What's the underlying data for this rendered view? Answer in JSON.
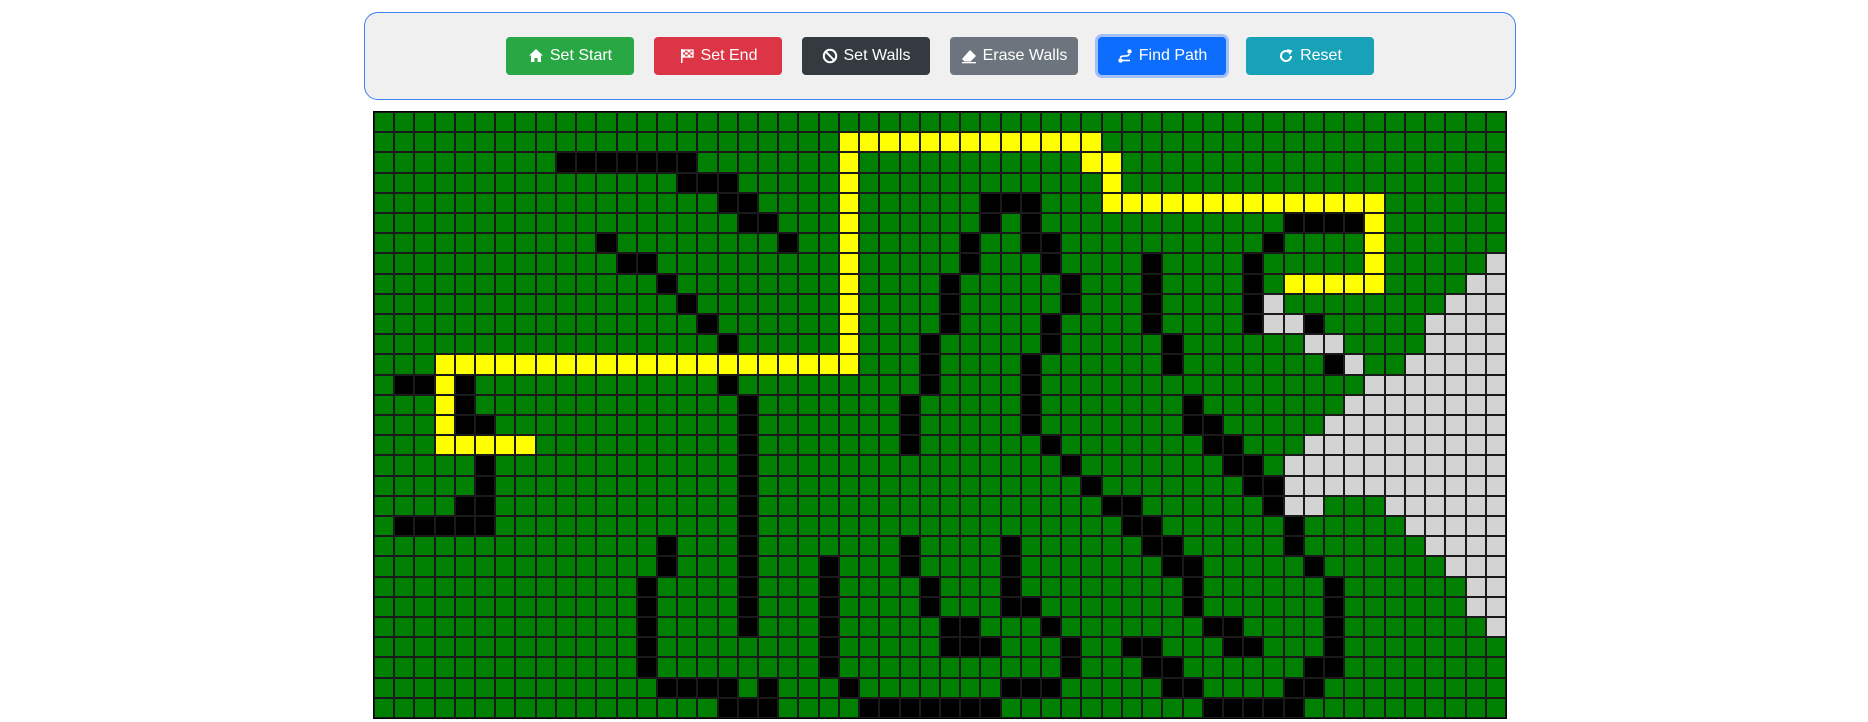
{
  "toolbar": {
    "buttons": [
      {
        "id": "start",
        "label": "Set Start",
        "icon": "home-icon",
        "color": "#28a745"
      },
      {
        "id": "end",
        "label": "Set End",
        "icon": "flag-checkered-icon",
        "color": "#dc3545"
      },
      {
        "id": "walls",
        "label": "Set Walls",
        "icon": "ban-icon",
        "color": "#343a40"
      },
      {
        "id": "erase",
        "label": "Erase Walls",
        "icon": "eraser-icon",
        "color": "#6c757d"
      },
      {
        "id": "find",
        "label": "Find Path",
        "icon": "route-icon",
        "color": "#0d6efd",
        "active": true
      },
      {
        "id": "reset",
        "label": "Reset",
        "icon": "redo-icon",
        "color": "#17a2b8"
      }
    ]
  },
  "grid": {
    "cols": 56,
    "rows": 30,
    "colors": {
      "empty": "#008000",
      "wall": "#000000",
      "path": "#ffff00",
      "visited": "#d3d3d3"
    },
    "walls": [
      [
        2,
        9
      ],
      [
        2,
        10
      ],
      [
        2,
        11
      ],
      [
        2,
        12
      ],
      [
        2,
        13
      ],
      [
        2,
        14
      ],
      [
        2,
        15
      ],
      [
        3,
        15
      ],
      [
        3,
        16
      ],
      [
        3,
        17
      ],
      [
        4,
        17
      ],
      [
        4,
        18
      ],
      [
        4,
        30
      ],
      [
        4,
        31
      ],
      [
        4,
        32
      ],
      [
        5,
        18
      ],
      [
        5,
        19
      ],
      [
        5,
        30
      ],
      [
        5,
        32
      ],
      [
        5,
        45
      ],
      [
        5,
        46
      ],
      [
        5,
        47
      ],
      [
        5,
        48
      ],
      [
        6,
        11
      ],
      [
        6,
        20
      ],
      [
        6,
        29
      ],
      [
        6,
        32
      ],
      [
        6,
        33
      ],
      [
        6,
        44
      ],
      [
        7,
        12
      ],
      [
        7,
        13
      ],
      [
        7,
        29
      ],
      [
        7,
        33
      ],
      [
        7,
        38
      ],
      [
        7,
        43
      ],
      [
        8,
        14
      ],
      [
        8,
        28
      ],
      [
        8,
        34
      ],
      [
        8,
        38
      ],
      [
        8,
        43
      ],
      [
        9,
        15
      ],
      [
        9,
        28
      ],
      [
        9,
        34
      ],
      [
        9,
        38
      ],
      [
        9,
        43
      ],
      [
        10,
        16
      ],
      [
        10,
        28
      ],
      [
        10,
        33
      ],
      [
        10,
        38
      ],
      [
        10,
        43
      ],
      [
        10,
        44
      ],
      [
        10,
        45
      ],
      [
        10,
        46
      ],
      [
        11,
        17
      ],
      [
        11,
        27
      ],
      [
        11,
        33
      ],
      [
        11,
        39
      ],
      [
        11,
        46
      ],
      [
        11,
        47
      ],
      [
        12,
        27
      ],
      [
        12,
        32
      ],
      [
        12,
        39
      ],
      [
        12,
        47
      ],
      [
        12,
        48
      ],
      [
        13,
        1
      ],
      [
        13,
        2
      ],
      [
        13,
        3
      ],
      [
        13,
        4
      ],
      [
        13,
        17
      ],
      [
        13,
        27
      ],
      [
        13,
        32
      ],
      [
        14,
        4
      ],
      [
        14,
        18
      ],
      [
        14,
        26
      ],
      [
        14,
        32
      ],
      [
        14,
        40
      ],
      [
        15,
        4
      ],
      [
        15,
        5
      ],
      [
        15,
        18
      ],
      [
        15,
        26
      ],
      [
        15,
        32
      ],
      [
        15,
        40
      ],
      [
        15,
        41
      ],
      [
        16,
        5
      ],
      [
        16,
        18
      ],
      [
        16,
        26
      ],
      [
        16,
        33
      ],
      [
        16,
        41
      ],
      [
        16,
        42
      ],
      [
        17,
        5
      ],
      [
        17,
        18
      ],
      [
        17,
        34
      ],
      [
        17,
        42
      ],
      [
        17,
        43
      ],
      [
        18,
        5
      ],
      [
        18,
        18
      ],
      [
        18,
        35
      ],
      [
        18,
        43
      ],
      [
        18,
        44
      ],
      [
        19,
        4
      ],
      [
        19,
        5
      ],
      [
        19,
        18
      ],
      [
        19,
        36
      ],
      [
        19,
        37
      ],
      [
        19,
        44
      ],
      [
        19,
        45
      ],
      [
        20,
        1
      ],
      [
        20,
        2
      ],
      [
        20,
        3
      ],
      [
        20,
        4
      ],
      [
        20,
        5
      ],
      [
        20,
        18
      ],
      [
        20,
        37
      ],
      [
        20,
        38
      ],
      [
        20,
        45
      ],
      [
        21,
        14
      ],
      [
        21,
        18
      ],
      [
        21,
        26
      ],
      [
        21,
        31
      ],
      [
        21,
        38
      ],
      [
        21,
        39
      ],
      [
        21,
        45
      ],
      [
        22,
        14
      ],
      [
        22,
        18
      ],
      [
        22,
        22
      ],
      [
        22,
        26
      ],
      [
        22,
        31
      ],
      [
        22,
        39
      ],
      [
        22,
        40
      ],
      [
        22,
        46
      ],
      [
        23,
        13
      ],
      [
        23,
        18
      ],
      [
        23,
        22
      ],
      [
        23,
        27
      ],
      [
        23,
        31
      ],
      [
        23,
        40
      ],
      [
        23,
        47
      ],
      [
        24,
        13
      ],
      [
        24,
        18
      ],
      [
        24,
        22
      ],
      [
        24,
        27
      ],
      [
        24,
        31
      ],
      [
        24,
        32
      ],
      [
        24,
        40
      ],
      [
        24,
        47
      ],
      [
        25,
        13
      ],
      [
        25,
        18
      ],
      [
        25,
        22
      ],
      [
        25,
        28
      ],
      [
        25,
        29
      ],
      [
        25,
        33
      ],
      [
        25,
        41
      ],
      [
        25,
        42
      ],
      [
        25,
        47
      ],
      [
        26,
        13
      ],
      [
        26,
        22
      ],
      [
        26,
        28
      ],
      [
        26,
        29
      ],
      [
        26,
        30
      ],
      [
        26,
        34
      ],
      [
        26,
        37
      ],
      [
        26,
        38
      ],
      [
        26,
        42
      ],
      [
        26,
        43
      ],
      [
        26,
        47
      ],
      [
        27,
        13
      ],
      [
        27,
        22
      ],
      [
        27,
        34
      ],
      [
        27,
        38
      ],
      [
        27,
        39
      ],
      [
        27,
        46
      ],
      [
        27,
        47
      ],
      [
        28,
        14
      ],
      [
        28,
        15
      ],
      [
        28,
        16
      ],
      [
        28,
        17
      ],
      [
        28,
        19
      ],
      [
        28,
        23
      ],
      [
        28,
        31
      ],
      [
        28,
        32
      ],
      [
        28,
        33
      ],
      [
        28,
        39
      ],
      [
        28,
        40
      ],
      [
        28,
        45
      ],
      [
        28,
        46
      ],
      [
        29,
        17
      ],
      [
        29,
        18
      ],
      [
        29,
        19
      ],
      [
        29,
        24
      ],
      [
        29,
        25
      ],
      [
        29,
        26
      ],
      [
        29,
        27
      ],
      [
        29,
        28
      ],
      [
        29,
        29
      ],
      [
        29,
        30
      ],
      [
        29,
        41
      ],
      [
        29,
        42
      ],
      [
        29,
        43
      ],
      [
        29,
        44
      ],
      [
        29,
        45
      ]
    ],
    "path": [
      [
        1,
        23
      ],
      [
        1,
        24
      ],
      [
        1,
        25
      ],
      [
        1,
        26
      ],
      [
        1,
        27
      ],
      [
        1,
        28
      ],
      [
        1,
        29
      ],
      [
        1,
        30
      ],
      [
        1,
        31
      ],
      [
        1,
        32
      ],
      [
        1,
        33
      ],
      [
        1,
        34
      ],
      [
        1,
        35
      ],
      [
        2,
        23
      ],
      [
        2,
        35
      ],
      [
        2,
        36
      ],
      [
        3,
        23
      ],
      [
        3,
        36
      ],
      [
        4,
        23
      ],
      [
        4,
        36
      ],
      [
        4,
        37
      ],
      [
        4,
        38
      ],
      [
        4,
        39
      ],
      [
        4,
        40
      ],
      [
        4,
        41
      ],
      [
        4,
        42
      ],
      [
        4,
        43
      ],
      [
        4,
        44
      ],
      [
        4,
        45
      ],
      [
        4,
        46
      ],
      [
        4,
        47
      ],
      [
        4,
        48
      ],
      [
        4,
        49
      ],
      [
        5,
        23
      ],
      [
        5,
        49
      ],
      [
        6,
        23
      ],
      [
        6,
        49
      ],
      [
        7,
        23
      ],
      [
        7,
        49
      ],
      [
        8,
        23
      ],
      [
        8,
        45
      ],
      [
        8,
        46
      ],
      [
        8,
        47
      ],
      [
        8,
        48
      ],
      [
        8,
        49
      ],
      [
        9,
        23
      ],
      [
        10,
        23
      ],
      [
        11,
        23
      ],
      [
        12,
        3
      ],
      [
        12,
        4
      ],
      [
        12,
        5
      ],
      [
        12,
        6
      ],
      [
        12,
        7
      ],
      [
        12,
        8
      ],
      [
        12,
        9
      ],
      [
        12,
        10
      ],
      [
        12,
        11
      ],
      [
        12,
        12
      ],
      [
        12,
        13
      ],
      [
        12,
        14
      ],
      [
        12,
        15
      ],
      [
        12,
        16
      ],
      [
        12,
        17
      ],
      [
        12,
        18
      ],
      [
        12,
        19
      ],
      [
        12,
        20
      ],
      [
        12,
        21
      ],
      [
        12,
        22
      ],
      [
        12,
        23
      ],
      [
        13,
        3
      ],
      [
        14,
        3
      ],
      [
        15,
        3
      ],
      [
        16,
        3
      ],
      [
        16,
        4
      ],
      [
        16,
        5
      ],
      [
        16,
        6
      ],
      [
        16,
        7
      ]
    ],
    "visited": [
      [
        7,
        55
      ],
      [
        8,
        54
      ],
      [
        8,
        55
      ],
      [
        9,
        44
      ],
      [
        9,
        53
      ],
      [
        9,
        54
      ],
      [
        9,
        55
      ],
      [
        10,
        44
      ],
      [
        10,
        45
      ],
      [
        10,
        52
      ],
      [
        10,
        53
      ],
      [
        10,
        54
      ],
      [
        10,
        55
      ],
      [
        11,
        46
      ],
      [
        11,
        47
      ],
      [
        11,
        52
      ],
      [
        11,
        53
      ],
      [
        11,
        54
      ],
      [
        11,
        55
      ],
      [
        12,
        48
      ],
      [
        12,
        51
      ],
      [
        12,
        52
      ],
      [
        12,
        53
      ],
      [
        12,
        54
      ],
      [
        12,
        55
      ],
      [
        13,
        49
      ],
      [
        13,
        50
      ],
      [
        13,
        51
      ],
      [
        13,
        52
      ],
      [
        13,
        53
      ],
      [
        13,
        54
      ],
      [
        13,
        55
      ],
      [
        14,
        48
      ],
      [
        14,
        49
      ],
      [
        14,
        50
      ],
      [
        14,
        51
      ],
      [
        14,
        52
      ],
      [
        14,
        53
      ],
      [
        14,
        54
      ],
      [
        14,
        55
      ],
      [
        15,
        47
      ],
      [
        15,
        48
      ],
      [
        15,
        49
      ],
      [
        15,
        50
      ],
      [
        15,
        51
      ],
      [
        15,
        52
      ],
      [
        15,
        53
      ],
      [
        15,
        54
      ],
      [
        15,
        55
      ],
      [
        16,
        46
      ],
      [
        16,
        47
      ],
      [
        16,
        48
      ],
      [
        16,
        49
      ],
      [
        16,
        50
      ],
      [
        16,
        51
      ],
      [
        16,
        52
      ],
      [
        16,
        53
      ],
      [
        16,
        54
      ],
      [
        16,
        55
      ],
      [
        17,
        45
      ],
      [
        17,
        46
      ],
      [
        17,
        47
      ],
      [
        17,
        48
      ],
      [
        17,
        49
      ],
      [
        17,
        50
      ],
      [
        17,
        51
      ],
      [
        17,
        52
      ],
      [
        17,
        53
      ],
      [
        17,
        54
      ],
      [
        17,
        55
      ],
      [
        18,
        45
      ],
      [
        18,
        46
      ],
      [
        18,
        47
      ],
      [
        18,
        48
      ],
      [
        18,
        49
      ],
      [
        18,
        50
      ],
      [
        18,
        51
      ],
      [
        18,
        52
      ],
      [
        18,
        53
      ],
      [
        18,
        54
      ],
      [
        18,
        55
      ],
      [
        19,
        45
      ],
      [
        19,
        46
      ],
      [
        19,
        50
      ],
      [
        19,
        51
      ],
      [
        19,
        52
      ],
      [
        19,
        53
      ],
      [
        19,
        54
      ],
      [
        19,
        55
      ],
      [
        20,
        51
      ],
      [
        20,
        52
      ],
      [
        20,
        53
      ],
      [
        20,
        54
      ],
      [
        20,
        55
      ],
      [
        21,
        52
      ],
      [
        21,
        53
      ],
      [
        21,
        54
      ],
      [
        21,
        55
      ],
      [
        22,
        53
      ],
      [
        22,
        54
      ],
      [
        22,
        55
      ],
      [
        23,
        54
      ],
      [
        23,
        55
      ],
      [
        24,
        54
      ],
      [
        24,
        55
      ],
      [
        25,
        55
      ]
    ]
  }
}
